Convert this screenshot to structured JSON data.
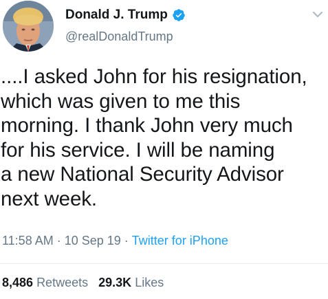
{
  "tweet": {
    "display_name": "Donald J. Trump",
    "handle": "@realDonaldTrump",
    "verified": true,
    "text": "....I asked John for his resignation,\nwhich was given to me this\nmorning. I thank John very much\nfor his service. I will be naming\na new National Security Advisor\nnext week.",
    "time": "11:58 AM",
    "separator": " · ",
    "date": "10 Sep 19",
    "source": "Twitter for iPhone",
    "retweets_count": "8,486",
    "retweets_label": "Retweets",
    "likes_count": "29.3K",
    "likes_label": "Likes"
  },
  "icons": {
    "verified": "verified-badge-icon",
    "menu": "chevron-down-icon"
  },
  "colors": {
    "text": "#14171a",
    "secondary": "#657786",
    "link": "#1da1f2",
    "verified": "#1da1f2",
    "divider": "#e6ecf0"
  }
}
